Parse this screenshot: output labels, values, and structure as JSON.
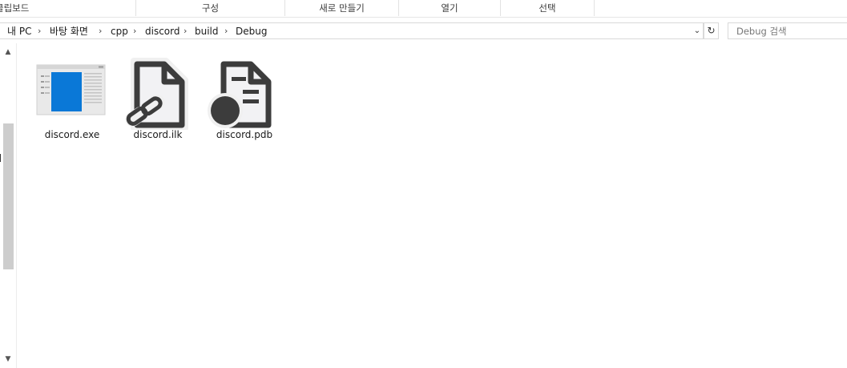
{
  "ribbon": {
    "groups": [
      "클립보드",
      "구성",
      "새로 만들기",
      "열기",
      "선택"
    ]
  },
  "address": {
    "crumbs": [
      "내 PC",
      "바탕 화면",
      "cpp",
      "discord",
      "build",
      "Debug"
    ],
    "separator": "›",
    "dropdown_icon": "chevron-down-icon",
    "refresh_icon": "refresh-icon",
    "refresh_glyph": "↻",
    "dropdown_glyph": "⌄"
  },
  "search": {
    "placeholder": "Debug 검색",
    "value": ""
  },
  "scrollbar": {
    "up_glyph": "▲",
    "down_glyph": "▼"
  },
  "files": [
    {
      "name": "discord.exe",
      "icon": "application-window-icon"
    },
    {
      "name": "discord.ilk",
      "icon": "linked-file-icon"
    },
    {
      "name": "discord.pdb",
      "icon": "debug-database-file-icon"
    }
  ],
  "colors": {
    "exe_blue": "#0a78d7",
    "icon_dark": "#3c3c3c",
    "icon_light": "#f0f0f0"
  }
}
